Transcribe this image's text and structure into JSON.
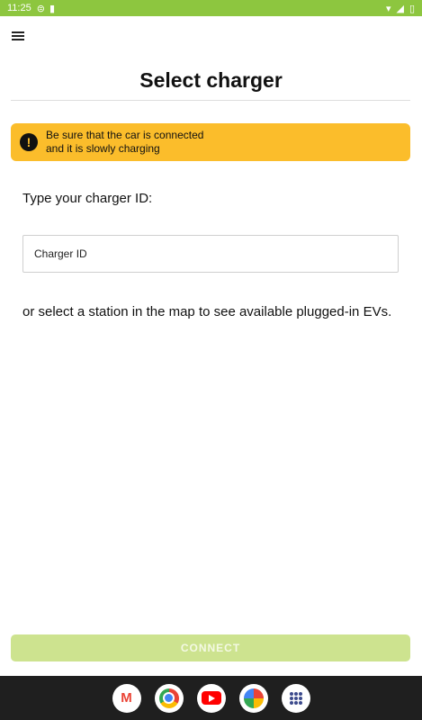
{
  "status_bar": {
    "time": "11:25",
    "left_icons": [
      "notification-icon",
      "sim-icon"
    ],
    "right_icons": [
      "wifi-icon",
      "signal-icon",
      "battery-icon"
    ]
  },
  "header": {
    "menu_icon": "hamburger-menu-icon",
    "title": "Select charger"
  },
  "warning": {
    "icon": "exclamation-icon",
    "line1": "Be sure that the car is connected",
    "line2": "and it is slowly charging",
    "color": "#fbbd2b"
  },
  "form": {
    "prompt": "Type your charger ID:",
    "charger_id_placeholder": "Charger ID",
    "charger_id_value": ""
  },
  "map_hint": "or select a station in the map to see available plugged-in EVs.",
  "connect_button": {
    "label": "CONNECT",
    "enabled": false,
    "color": "#cde38f"
  },
  "theme": {
    "accent": "#8dc63f"
  },
  "nav_bar": {
    "apps": [
      "gmail-icon",
      "chrome-icon",
      "youtube-icon",
      "photos-icon",
      "app-drawer-icon"
    ]
  }
}
